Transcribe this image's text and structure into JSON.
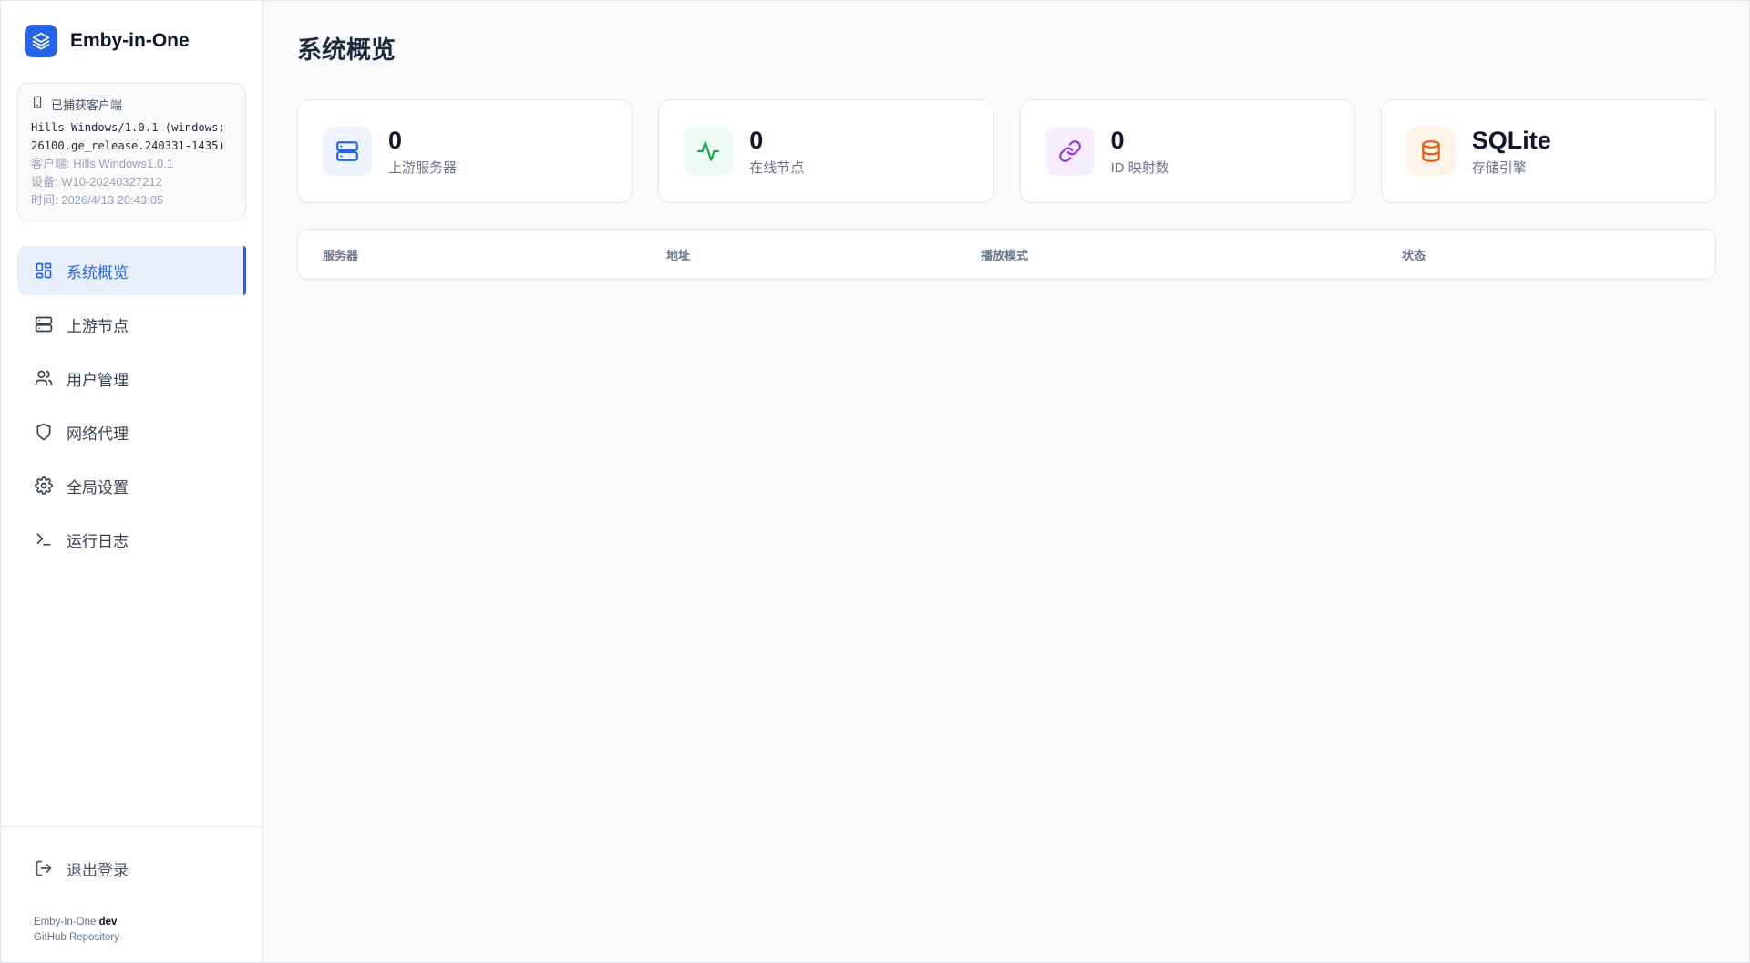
{
  "brand": {
    "name": "Emby-in-One"
  },
  "client": {
    "header": "已捕获客户端",
    "user_agent": "Hills Windows/1.0.1 (windows; 26100.ge_release.240331-1435)",
    "client_label": "客户端: Hills Windows1.0.1",
    "device_label": "设备: W10-20240327212",
    "time_label": "时间: 2026/4/13 20:43:05"
  },
  "nav": {
    "items": [
      {
        "label": "系统概览",
        "icon": "dashboard-icon",
        "active": true
      },
      {
        "label": "上游节点",
        "icon": "server-icon"
      },
      {
        "label": "用户管理",
        "icon": "users-icon"
      },
      {
        "label": "网络代理",
        "icon": "shield-icon"
      },
      {
        "label": "全局设置",
        "icon": "gear-icon"
      },
      {
        "label": "运行日志",
        "icon": "terminal-icon"
      }
    ]
  },
  "footer": {
    "logout_label": "退出登录",
    "app_name": "Emby-In-One",
    "version": "dev",
    "repo_label": "GitHub Repository"
  },
  "main": {
    "title": "系统概览",
    "stats": [
      {
        "value": "0",
        "label": "上游服务器",
        "icon": "server-icon",
        "color": "#2563eb",
        "bg": "#eef4ff"
      },
      {
        "value": "0",
        "label": "在线节点",
        "icon": "activity-icon",
        "color": "#16a34a",
        "bg": "#edfbf2"
      },
      {
        "value": "0",
        "label": "ID 映射数",
        "icon": "link-icon",
        "color": "#9333ea",
        "bg": "#f7efff"
      },
      {
        "value": "SQLite",
        "label": "存储引擎",
        "icon": "database-icon",
        "color": "#ea580c",
        "bg": "#fff4e8"
      }
    ],
    "table": {
      "columns": [
        "服务器",
        "地址",
        "播放模式",
        "状态"
      ]
    }
  }
}
